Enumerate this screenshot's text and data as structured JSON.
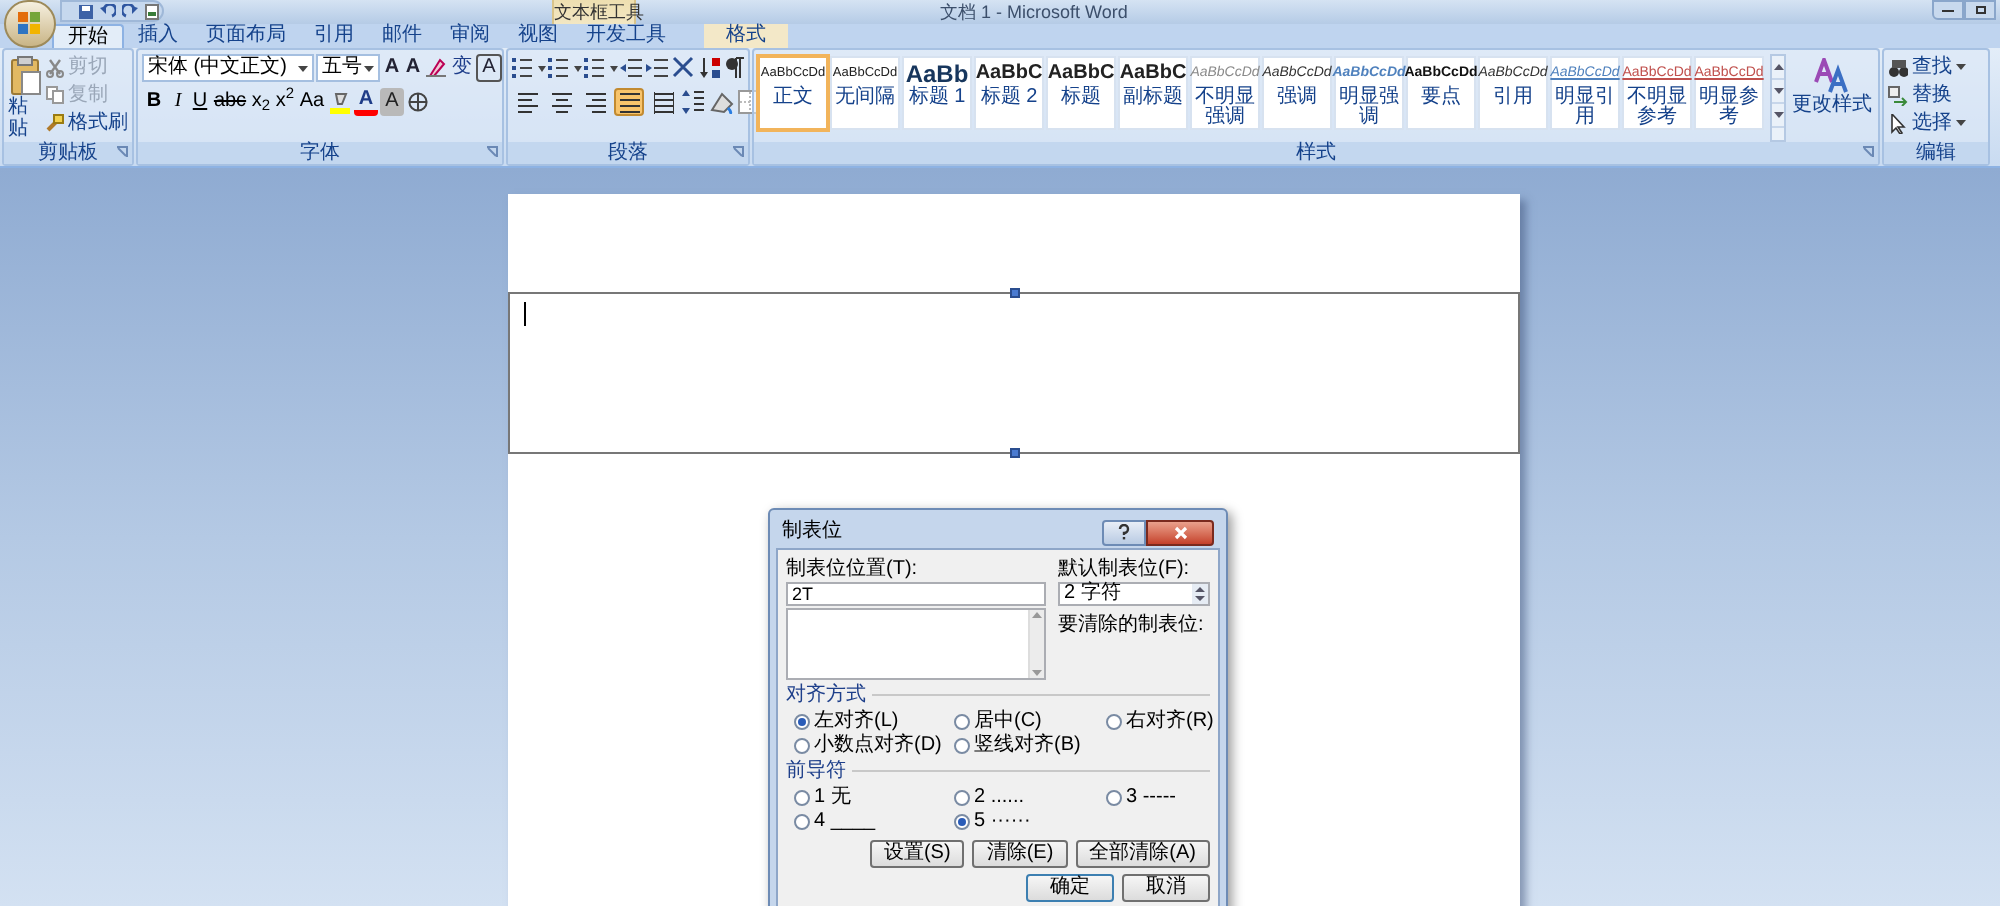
{
  "title_bar": {
    "contextual_tab": "文本框工具",
    "title": "文档 1 - Microsoft Word"
  },
  "tabs": [
    {
      "label": "开始",
      "selected": true,
      "contextual": false
    },
    {
      "label": "插入",
      "selected": false,
      "contextual": false
    },
    {
      "label": "页面布局",
      "selected": false,
      "contextual": false
    },
    {
      "label": "引用",
      "selected": false,
      "contextual": false
    },
    {
      "label": "邮件",
      "selected": false,
      "contextual": false
    },
    {
      "label": "审阅",
      "selected": false,
      "contextual": false
    },
    {
      "label": "视图",
      "selected": false,
      "contextual": false
    },
    {
      "label": "开发工具",
      "selected": false,
      "contextual": false
    },
    {
      "label": "格式",
      "selected": false,
      "contextual": true
    }
  ],
  "clipboard": {
    "label": "剪贴板",
    "paste": "粘贴",
    "items": [
      {
        "label": "剪切",
        "disabled": true
      },
      {
        "label": "复制",
        "disabled": true
      },
      {
        "label": "格式刷",
        "disabled": false
      }
    ]
  },
  "font": {
    "label": "字体",
    "font_name": "宋体 (中文正文)",
    "font_size": "五号",
    "top_buttons": [
      {
        "kind": "grow",
        "label": "A"
      },
      {
        "kind": "shrink",
        "label": "A"
      },
      {
        "kind": "clear"
      },
      {
        "kind": "phonetic",
        "label": "变"
      },
      {
        "kind": "border",
        "label": "A"
      }
    ],
    "bottom_buttons": [
      {
        "kind": "bold",
        "label": "B"
      },
      {
        "kind": "italic",
        "label": "I"
      },
      {
        "kind": "underline",
        "label": "U"
      },
      {
        "kind": "strike",
        "label": "abc"
      },
      {
        "kind": "sub",
        "label": "x$_{2}$"
      },
      {
        "kind": "sup",
        "label": "x$^{2}$"
      },
      {
        "kind": "case",
        "label": "Aa"
      },
      {
        "kind": "highlight"
      },
      {
        "kind": "color",
        "label": "A"
      },
      {
        "kind": "shading",
        "label": "A"
      },
      {
        "kind": "enclose"
      }
    ]
  },
  "paragraph": {
    "label": "段落",
    "alignment": [
      {
        "kind": "left",
        "selected": false
      },
      {
        "kind": "center",
        "selected": false
      },
      {
        "kind": "right",
        "selected": false
      },
      {
        "kind": "justify",
        "selected": true
      },
      {
        "kind": "distributed",
        "selected": false
      }
    ]
  },
  "styles": {
    "label": "样式",
    "change_styles": "更改样式",
    "items": [
      {
        "kind": "normal",
        "sample": "AaBbCcDd",
        "name": "正文",
        "selected": true
      },
      {
        "kind": "normal",
        "sample": "AaBbCcDd",
        "name": "无间隔",
        "selected": false
      },
      {
        "kind": "heading1",
        "sample": "AaBb",
        "name": "标题 1",
        "selected": false
      },
      {
        "kind": "heading2",
        "sample": "AaBbC",
        "name": "标题 2",
        "selected": false
      },
      {
        "kind": "heading2",
        "sample": "AaBbC",
        "name": "标题",
        "selected": false
      },
      {
        "kind": "heading2",
        "sample": "AaBbC",
        "name": "副标题",
        "selected": false
      },
      {
        "kind": "subtle",
        "sample": "AaBbCcDd",
        "name": "不明显强调",
        "selected": false
      },
      {
        "kind": "emphasis",
        "sample": "AaBbCcDd",
        "name": "强调",
        "selected": false
      },
      {
        "kind": "intense",
        "sample": "AaBbCcDd",
        "name": "明显强调",
        "selected": false
      },
      {
        "kind": "strong",
        "sample": "AaBbCcDd",
        "name": "要点",
        "selected": false
      },
      {
        "kind": "emphasis",
        "sample": "AaBbCcDd",
        "name": "引用",
        "selected": false
      },
      {
        "kind": "intense_quote",
        "sample": "AaBbCcDd",
        "name": "明显引用",
        "selected": false
      },
      {
        "kind": "reference",
        "sample": "AaBbCcDd",
        "name": "不明显参考",
        "selected": false
      },
      {
        "kind": "reference",
        "sample": "AaBbCcDd",
        "name": "明显参考",
        "selected": false
      }
    ]
  },
  "editing": {
    "label": "编辑",
    "items": [
      {
        "label": "查找",
        "dropdown": true
      },
      {
        "label": "替换",
        "dropdown": false
      },
      {
        "label": "选择",
        "dropdown": true
      }
    ]
  },
  "dialog": {
    "title": "制表位",
    "tab_stop_label": "制表位位置(T):",
    "tab_stop_value": "2T",
    "default_label": "默认制表位(F):",
    "default_value": "2 字符",
    "clear_label": "要清除的制表位:",
    "alignment": {
      "label": "对齐方式",
      "options": [
        {
          "label": "左对齐(L)",
          "selected": true
        },
        {
          "label": "居中(C)",
          "selected": false
        },
        {
          "label": "右对齐(R)",
          "selected": false
        },
        {
          "label": "小数点对齐(D)",
          "selected": false
        },
        {
          "label": "竖线对齐(B)",
          "selected": false
        }
      ]
    },
    "leader": {
      "label": "前导符",
      "options": [
        {
          "label": "1 无",
          "selected": false
        },
        {
          "label": "2 ......",
          "selected": false
        },
        {
          "label": "3 -----",
          "selected": false
        },
        {
          "label": "4 ____",
          "selected": false
        },
        {
          "label": "5 ······",
          "selected": true
        }
      ]
    },
    "buttons": [
      "设置(S)",
      "清除(E)",
      "全部清除(A)"
    ],
    "footer_buttons": [
      "确定",
      "取消"
    ]
  }
}
